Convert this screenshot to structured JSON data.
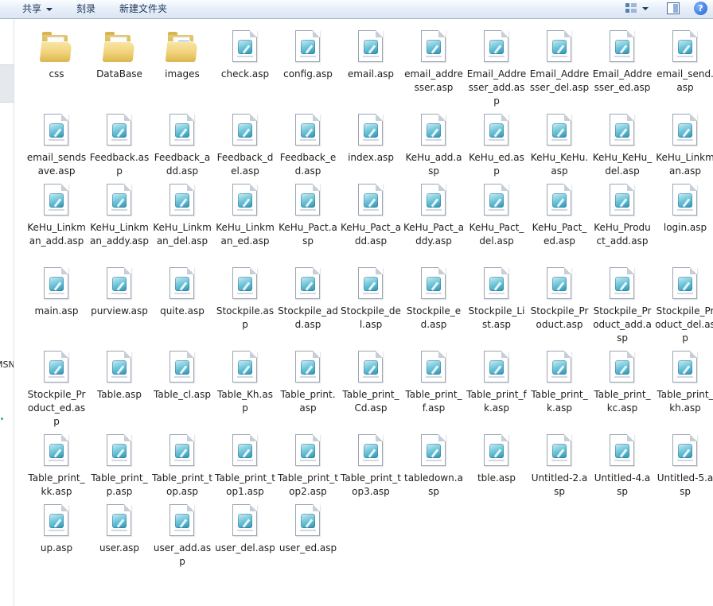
{
  "toolbar": {
    "share_label": "共享",
    "burn_label": "刻录",
    "new_folder_label": "新建文件夹",
    "view_icon": "view-options-icon",
    "preview_icon": "preview-pane-icon",
    "help_icon": "help-icon",
    "help_glyph": "?"
  },
  "nav": {
    "partial_label": "MSN"
  },
  "files": [
    {
      "name": "css",
      "type": "folder"
    },
    {
      "name": "DataBase",
      "type": "folder"
    },
    {
      "name": "images",
      "type": "folder-images"
    },
    {
      "name": "check.asp",
      "type": "asp"
    },
    {
      "name": "config.asp",
      "type": "asp"
    },
    {
      "name": "email.asp",
      "type": "asp"
    },
    {
      "name": "email_addresser.asp",
      "type": "asp"
    },
    {
      "name": "Email_Addresser_add.asp",
      "type": "asp"
    },
    {
      "name": "Email_Addresser_del.asp",
      "type": "asp"
    },
    {
      "name": "Email_Addresser_ed.asp",
      "type": "asp"
    },
    {
      "name": "email_send.asp",
      "type": "asp"
    },
    {
      "name": "email_sendsave.asp",
      "type": "asp"
    },
    {
      "name": "Feedback.asp",
      "type": "asp"
    },
    {
      "name": "Feedback_add.asp",
      "type": "asp"
    },
    {
      "name": "Feedback_del.asp",
      "type": "asp"
    },
    {
      "name": "Feedback_ed.asp",
      "type": "asp"
    },
    {
      "name": "index.asp",
      "type": "asp"
    },
    {
      "name": "KeHu_add.asp",
      "type": "asp"
    },
    {
      "name": "KeHu_ed.asp",
      "type": "asp"
    },
    {
      "name": "KeHu_KeHu.asp",
      "type": "asp"
    },
    {
      "name": "KeHu_KeHu_del.asp",
      "type": "asp"
    },
    {
      "name": "KeHu_Linkman.asp",
      "type": "asp"
    },
    {
      "name": "KeHu_Linkman_add.asp",
      "type": "asp"
    },
    {
      "name": "KeHu_Linkman_addy.asp",
      "type": "asp"
    },
    {
      "name": "KeHu_Linkman_del.asp",
      "type": "asp"
    },
    {
      "name": "KeHu_Linkman_ed.asp",
      "type": "asp"
    },
    {
      "name": "KeHu_Pact.asp",
      "type": "asp"
    },
    {
      "name": "KeHu_Pact_add.asp",
      "type": "asp"
    },
    {
      "name": "KeHu_Pact_addy.asp",
      "type": "asp"
    },
    {
      "name": "KeHu_Pact_del.asp",
      "type": "asp"
    },
    {
      "name": "KeHu_Pact_ed.asp",
      "type": "asp"
    },
    {
      "name": "KeHu_Product_add.asp",
      "type": "asp"
    },
    {
      "name": "login.asp",
      "type": "asp"
    },
    {
      "name": "main.asp",
      "type": "asp"
    },
    {
      "name": "purview.asp",
      "type": "asp"
    },
    {
      "name": "quite.asp",
      "type": "asp"
    },
    {
      "name": "Stockpile.asp",
      "type": "asp"
    },
    {
      "name": "Stockpile_add.asp",
      "type": "asp"
    },
    {
      "name": "Stockpile_del.asp",
      "type": "asp"
    },
    {
      "name": "Stockpile_ed.asp",
      "type": "asp"
    },
    {
      "name": "Stockpile_List.asp",
      "type": "asp"
    },
    {
      "name": "Stockpile_Product.asp",
      "type": "asp"
    },
    {
      "name": "Stockpile_Product_add.asp",
      "type": "asp"
    },
    {
      "name": "Stockpile_Product_del.asp",
      "type": "asp"
    },
    {
      "name": "Stockpile_Product_ed.asp",
      "type": "asp"
    },
    {
      "name": "Table.asp",
      "type": "asp"
    },
    {
      "name": "Table_cl.asp",
      "type": "asp"
    },
    {
      "name": "Table_Kh.asp",
      "type": "asp"
    },
    {
      "name": "Table_print.asp",
      "type": "asp"
    },
    {
      "name": "Table_print_Cd.asp",
      "type": "asp"
    },
    {
      "name": "Table_print_f.asp",
      "type": "asp"
    },
    {
      "name": "Table_print_fk.asp",
      "type": "asp"
    },
    {
      "name": "Table_print_k.asp",
      "type": "asp"
    },
    {
      "name": "Table_print_kc.asp",
      "type": "asp"
    },
    {
      "name": "Table_print_kh.asp",
      "type": "asp"
    },
    {
      "name": "Table_print_kk.asp",
      "type": "asp"
    },
    {
      "name": "Table_print_p.asp",
      "type": "asp"
    },
    {
      "name": "Table_print_top.asp",
      "type": "asp"
    },
    {
      "name": "Table_print_top1.asp",
      "type": "asp"
    },
    {
      "name": "Table_print_top2.asp",
      "type": "asp"
    },
    {
      "name": "Table_print_top3.asp",
      "type": "asp"
    },
    {
      "name": "tabledown.asp",
      "type": "asp"
    },
    {
      "name": "tble.asp",
      "type": "asp"
    },
    {
      "name": "Untitled-2.asp",
      "type": "asp"
    },
    {
      "name": "Untitled-4.asp",
      "type": "asp"
    },
    {
      "name": "Untitled-5.asp",
      "type": "asp"
    },
    {
      "name": "up.asp",
      "type": "asp"
    },
    {
      "name": "user.asp",
      "type": "asp"
    },
    {
      "name": "user_add.asp",
      "type": "asp"
    },
    {
      "name": "user_del.asp",
      "type": "asp"
    },
    {
      "name": "user_ed.asp",
      "type": "asp"
    }
  ]
}
